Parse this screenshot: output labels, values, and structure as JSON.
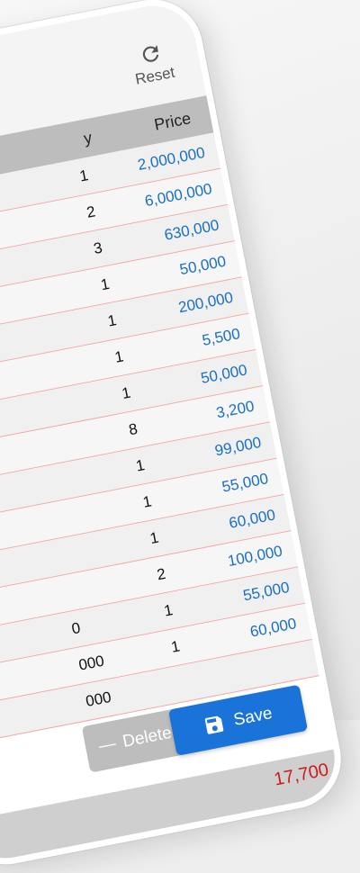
{
  "topbar": {
    "text": "y",
    "reset_label": "Reset"
  },
  "table": {
    "headers": {
      "qty": "y",
      "price": "Price"
    },
    "rows": [
      {
        "name": "",
        "qty": "1",
        "price": "2,000,000"
      },
      {
        "name": "",
        "qty": "2",
        "price": "6,000,000"
      },
      {
        "name": "",
        "qty": "3",
        "price": "630,000"
      },
      {
        "name": "",
        "qty": "1",
        "price": "50,000"
      },
      {
        "name": "",
        "qty": "1",
        "price": "200,000"
      },
      {
        "name": "",
        "qty": "1",
        "price": "5,500"
      },
      {
        "name": "",
        "qty": "1",
        "price": "50,000"
      },
      {
        "name": "",
        "qty": "8",
        "price": "3,200"
      },
      {
        "name": "",
        "qty": "1",
        "price": "99,000"
      },
      {
        "name": "",
        "qty": "1",
        "price": "55,000"
      },
      {
        "name": "",
        "qty": "1",
        "price": "60,000"
      },
      {
        "name": "",
        "qty": "2",
        "price": "100,000"
      },
      {
        "name": "0",
        "qty": "1",
        "price": "55,000"
      },
      {
        "name": "000",
        "qty": "1",
        "price": "60,000"
      },
      {
        "name": "000",
        "qty": "",
        "price": ""
      }
    ]
  },
  "buttons": {
    "delete_label": "Delete list",
    "save_label": "Save"
  },
  "total": {
    "value": "17,700"
  },
  "colors": {
    "accent": "#1a73d9",
    "price": "#1a6fc4",
    "total": "#cc1a1a",
    "divider": "#f4a7a7"
  }
}
